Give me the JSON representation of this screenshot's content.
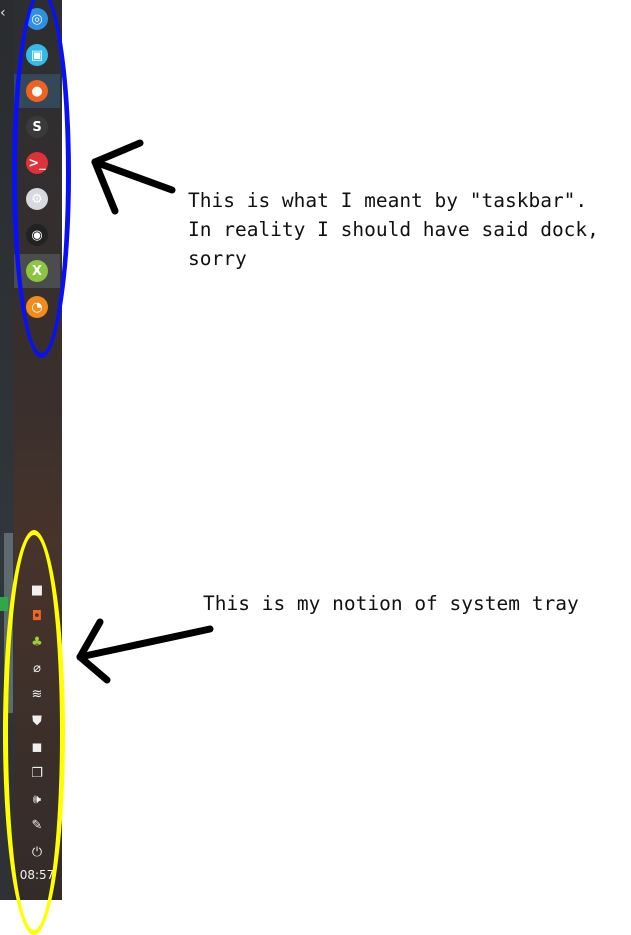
{
  "left_strip": {
    "close_glyph": "‹"
  },
  "dock": {
    "items": [
      {
        "id": "deepin-launcher",
        "icon": "deepin-logo-icon",
        "color": "#2f8fe0",
        "glyph": "◎"
      },
      {
        "id": "app-store",
        "icon": "store-icon",
        "color": "#35b9e6",
        "glyph": "▣"
      },
      {
        "id": "firefox",
        "icon": "firefox-icon",
        "color": "#f0621f",
        "glyph": "●",
        "active": true
      },
      {
        "id": "sublime",
        "icon": "sublime-icon",
        "color": "#3a3a3a",
        "glyph": "S"
      },
      {
        "id": "terminal",
        "icon": "terminal-icon",
        "color": "#e0303a",
        "glyph": ">_"
      },
      {
        "id": "settings",
        "icon": "gear-icon",
        "color": "#d8d8e0",
        "glyph": "⚙"
      },
      {
        "id": "color-picker",
        "icon": "color-wheel-icon",
        "color": "#222",
        "glyph": "◉"
      },
      {
        "id": "xmind",
        "icon": "xmind-icon",
        "color": "#8cc540",
        "glyph": "X",
        "active2": true
      },
      {
        "id": "screenshot",
        "icon": "screenshot-icon",
        "color": "#f28a1c",
        "glyph": "◔"
      }
    ]
  },
  "tray": {
    "items": [
      {
        "id": "notification",
        "icon": "white-square-icon",
        "glyph": "■"
      },
      {
        "id": "ubuntu-one",
        "icon": "cloud-sync-icon",
        "glyph": "◘"
      },
      {
        "id": "android",
        "icon": "android-icon",
        "glyph": "♣"
      },
      {
        "id": "clipboard",
        "icon": "paperclip-icon",
        "glyph": "⌀"
      },
      {
        "id": "wifi",
        "icon": "wifi-icon",
        "glyph": "≋"
      },
      {
        "id": "shield",
        "icon": "shield-icon",
        "glyph": "⛊"
      },
      {
        "id": "keyboard",
        "icon": "black-square-icon",
        "glyph": "◼"
      },
      {
        "id": "windows",
        "icon": "window-stack-icon",
        "glyph": "❐"
      },
      {
        "id": "volume",
        "icon": "speaker-icon",
        "glyph": "🕪"
      },
      {
        "id": "pen",
        "icon": "pen-icon",
        "glyph": "✎"
      },
      {
        "id": "power",
        "icon": "power-icon",
        "glyph": "⏻"
      }
    ],
    "clock": "08:57"
  },
  "annotations": {
    "taskbar_note": "This is what I meant by \"taskbar\".\nIn reality I should have said dock,\nsorry",
    "tray_note": "This is my notion of system tray"
  },
  "colors": {
    "blue_circle": "#0a10f5",
    "yellow_circle": "#ffff00"
  }
}
